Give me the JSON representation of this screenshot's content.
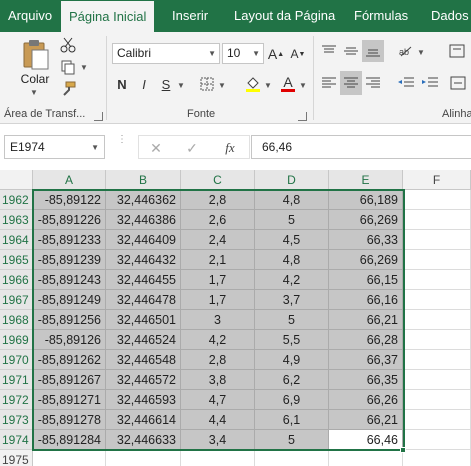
{
  "tabs": [
    {
      "label": "Arquivo",
      "active": false
    },
    {
      "label": "Página Inicial",
      "active": true
    },
    {
      "label": "Inserir",
      "active": false
    },
    {
      "label": "Layout da Página",
      "active": false
    },
    {
      "label": "Fórmulas",
      "active": false
    },
    {
      "label": "Dados",
      "active": false
    }
  ],
  "ribbon": {
    "clipboard": {
      "paste_label": "Colar",
      "group_label": "Área de Transf..."
    },
    "font": {
      "name": "Calibri",
      "size": "10",
      "group_label": "Fonte",
      "bold": "N",
      "italic": "I",
      "underline": "S",
      "grow": "A",
      "shrink": "A",
      "font_color_letter": "A"
    },
    "alignment": {
      "group_label": "Alinha"
    }
  },
  "formula_bar": {
    "name_box": "E1974",
    "fx": "fx",
    "value": "66,46"
  },
  "sheet": {
    "columns": [
      "A",
      "B",
      "C",
      "D",
      "E",
      "F"
    ],
    "rows": [
      {
        "num": "1962",
        "cells": [
          "-85,89122",
          "32,446362",
          "2,8",
          "4,8",
          "66,189"
        ]
      },
      {
        "num": "1963",
        "cells": [
          "-85,891226",
          "32,446386",
          "2,6",
          "5",
          "66,269"
        ]
      },
      {
        "num": "1964",
        "cells": [
          "-85,891233",
          "32,446409",
          "2,4",
          "4,5",
          "66,33"
        ]
      },
      {
        "num": "1965",
        "cells": [
          "-85,891239",
          "32,446432",
          "2,1",
          "4,8",
          "66,269"
        ]
      },
      {
        "num": "1966",
        "cells": [
          "-85,891243",
          "32,446455",
          "1,7",
          "4,2",
          "66,15"
        ]
      },
      {
        "num": "1967",
        "cells": [
          "-85,891249",
          "32,446478",
          "1,7",
          "3,7",
          "66,16"
        ]
      },
      {
        "num": "1968",
        "cells": [
          "-85,891256",
          "32,446501",
          "3",
          "5",
          "66,21"
        ]
      },
      {
        "num": "1969",
        "cells": [
          "-85,89126",
          "32,446524",
          "4,2",
          "5,5",
          "66,28"
        ]
      },
      {
        "num": "1970",
        "cells": [
          "-85,891262",
          "32,446548",
          "2,8",
          "4,9",
          "66,37"
        ]
      },
      {
        "num": "1971",
        "cells": [
          "-85,891267",
          "32,446572",
          "3,8",
          "6,2",
          "66,35"
        ]
      },
      {
        "num": "1972",
        "cells": [
          "-85,891271",
          "32,446593",
          "4,7",
          "6,9",
          "66,26"
        ]
      },
      {
        "num": "1973",
        "cells": [
          "-85,891278",
          "32,446614",
          "4,4",
          "6,1",
          "66,21"
        ]
      },
      {
        "num": "1974",
        "cells": [
          "-85,891284",
          "32,446633",
          "3,4",
          "5",
          "66,46"
        ]
      },
      {
        "num": "1975",
        "cells": [
          "",
          "",
          "",
          "",
          ""
        ]
      }
    ],
    "active_cell": "E1974"
  },
  "colors": {
    "accent": "#217346",
    "selection_fill": "#c6c6c6"
  }
}
